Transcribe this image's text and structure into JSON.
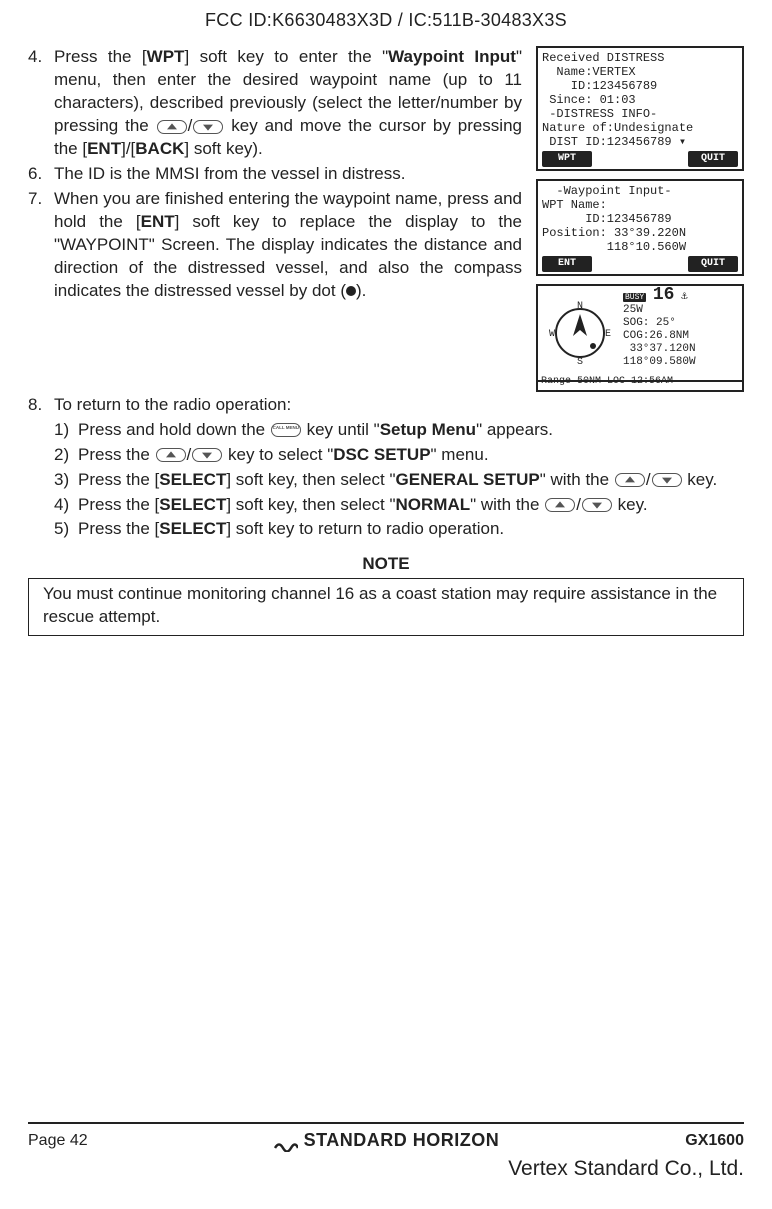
{
  "header": {
    "fcc": "FCC ID:K6630483X3D / IC:511B-30483X3S"
  },
  "steps": {
    "s4": {
      "num": "4.",
      "pre": "Press the [",
      "wpt": "WPT",
      "a": "] soft key to enter the \"",
      "menu_name": "Waypoint Input",
      "b": "\" menu, then enter the desired waypoint name (up to 11 characters), described previously (select the letter/number by pressing the ",
      "c": " key and move the cursor by pressing the [",
      "ent": "ENT",
      "d": "]/[",
      "back": "BACK",
      "e": "] soft key)."
    },
    "s6": {
      "num": "6.",
      "text": "The ID is the MMSI from the vessel in distress."
    },
    "s7": {
      "num": "7.",
      "a": "When you are finished entering the waypoint name, press and hold the [",
      "ent": "ENT",
      "b": "] soft key to replace the display to the \"WAYPOINT\" Screen. The display indicates the distance and direction of the distressed vessel, and also the compass indicates the distressed vessel by dot (",
      "c": ")."
    },
    "s8": {
      "num": "8.",
      "text": "To return to the radio operation:"
    }
  },
  "sub": {
    "s1": {
      "num": "1)",
      "a": "Press and hold down the ",
      "b": " key until \"",
      "menu": "Setup Menu",
      "c": "\" appears."
    },
    "s2": {
      "num": "2)",
      "a": "Press the ",
      "b": " key to select \"",
      "menu": "DSC SETUP",
      "c": "\" menu."
    },
    "s3": {
      "num": "3)",
      "a": "Press the [",
      "select": "SELECT",
      "b": "] soft key, then select \"",
      "menu": "GENERAL SETUP",
      "c": "\" with the ",
      "d": " key."
    },
    "s4": {
      "num": "4)",
      "a": "Press the [",
      "select": "SELECT",
      "b": "] soft key, then select \"",
      "menu": "NORMAL",
      "c": "\" with the ",
      "d": " key."
    },
    "s5": {
      "num": "5)",
      "a": "Press the [",
      "select": "SELECT",
      "b": "] soft key to return to radio operation."
    }
  },
  "note": {
    "title": "NOTE",
    "text": "You must continue monitoring channel 16 as a coast station may require assistance in the rescue attempt."
  },
  "lcd1": {
    "l1": "Received DISTRESS",
    "l2": "  Name:VERTEX",
    "l3": "    ID:123456789",
    "l4": " Since: 01:03",
    "l5": " -DISTRESS INFO-",
    "l6": "Nature of:Undesignate",
    "l7": " DIST ID:123456789 ▾",
    "sk1": "WPT",
    "sk2": "QUIT"
  },
  "lcd2": {
    "l1": "  -Waypoint Input-",
    "l2": "WPT Name:",
    "l3": "      ID:123456789",
    "l4": "",
    "l5": "Position: 33°39.220N",
    "l6": "         118°10.560W",
    "sk1": "ENT",
    "sk2": "QUIT"
  },
  "lcd3": {
    "busy": "BUSY",
    "pw": "25W",
    "ch": "16",
    "l1": "SOG: 25°",
    "l2": "COG:26.8NM",
    "l3": " 33°37.120N",
    "l4": "118°09.580W",
    "range": "Range 50NM LOC 12:56AM"
  },
  "footer": {
    "page": "Page 42",
    "brand": "STANDARD HORIZON",
    "model": "GX1600",
    "vertex": "Vertex Standard Co., Ltd."
  }
}
